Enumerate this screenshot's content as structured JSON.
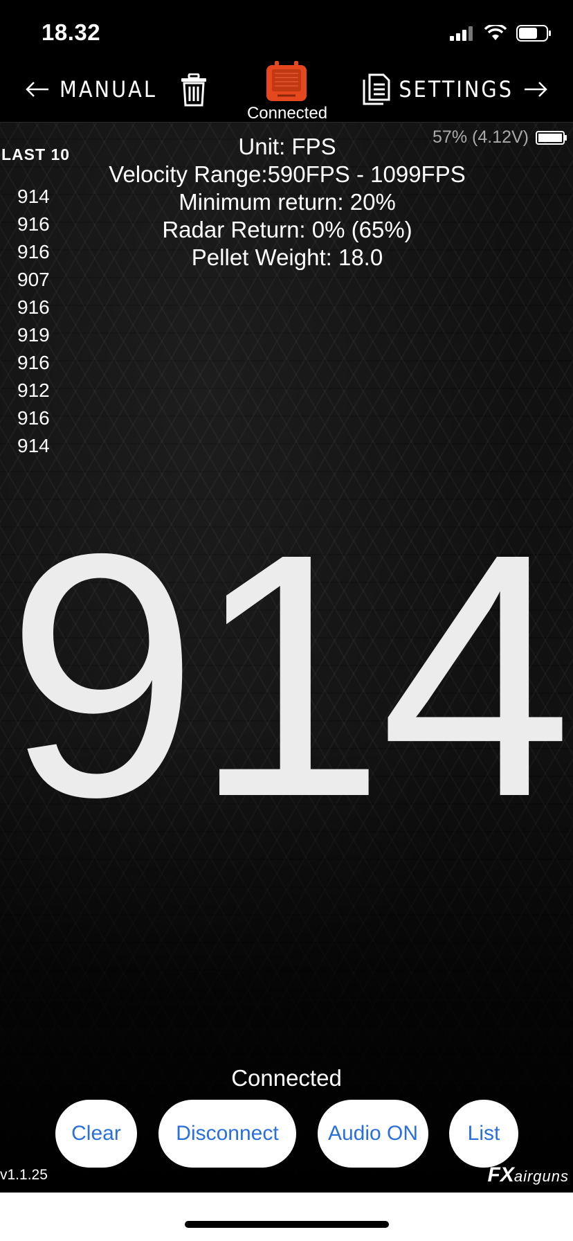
{
  "status_bar": {
    "time": "18.32",
    "icons": [
      "signal-icon",
      "wifi-icon",
      "battery-icon"
    ]
  },
  "nav": {
    "manual_label": "MANUAL",
    "settings_label": "SETTINGS",
    "device_status": "Connected",
    "device_color": "#e5481f"
  },
  "info": {
    "unit": "Unit:  FPS",
    "velocity_range": "Velocity Range:590FPS - 1099FPS",
    "minimum_return": "Minimum return: 20%",
    "radar_return": "Radar Return:  0%  (65%)",
    "pellet_weight": "Pellet Weight:  18.0"
  },
  "device_battery": "57% (4.12V)",
  "last10": {
    "title": "LAST 10",
    "shots": [
      "914",
      "916",
      "916",
      "907",
      "916",
      "919",
      "916",
      "912",
      "916",
      "914"
    ]
  },
  "reading": "914",
  "bottom": {
    "status": "Connected",
    "buttons": {
      "clear": "Clear",
      "disconnect": "Disconnect",
      "audio": "Audio ON",
      "list": "List"
    },
    "version": "v1.1.25",
    "brand_fx": "FX",
    "brand_airguns": "airguns"
  },
  "colors": {
    "accent_blue": "#2a6fde",
    "background": "#000000"
  }
}
